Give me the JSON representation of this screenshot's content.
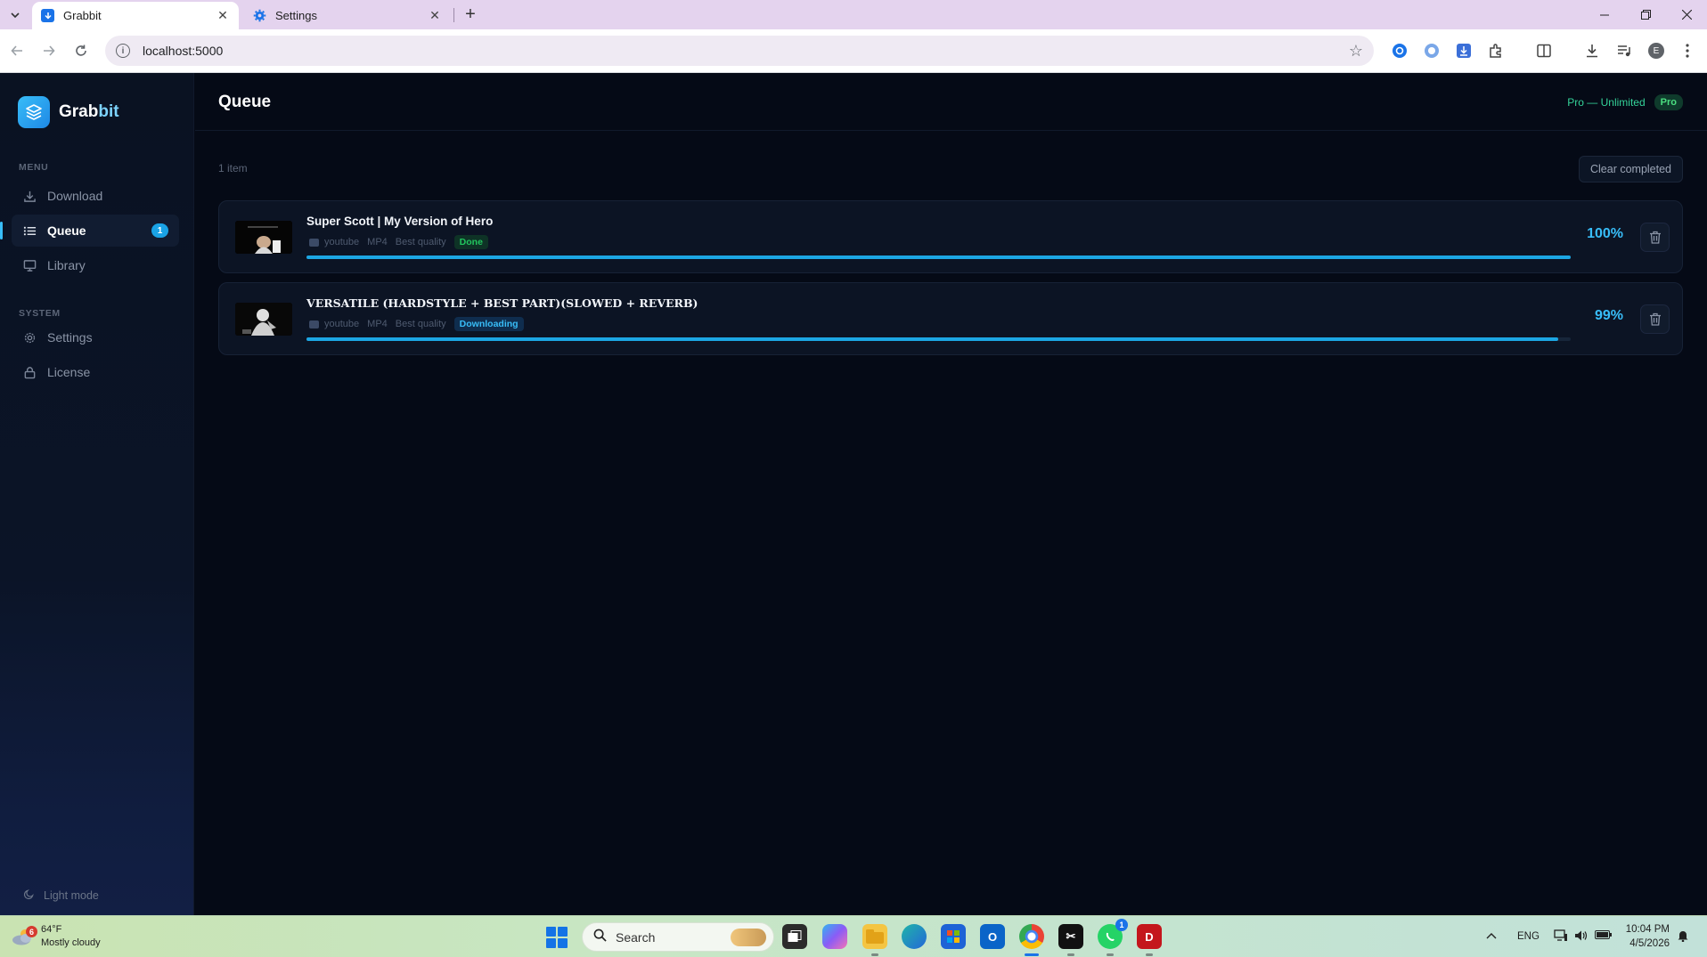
{
  "browser": {
    "tabs": [
      {
        "title": "Grabbit",
        "active": true
      },
      {
        "title": "Settings",
        "active": false
      }
    ],
    "url": "localhost:5000",
    "profile_initial": "E"
  },
  "sidebar": {
    "brand_prefix": "Grab",
    "brand_suffix": "bit",
    "menu_label": "MENU",
    "menu_items": [
      {
        "label": "Download",
        "icon": "download-icon"
      },
      {
        "label": "Queue",
        "icon": "list-icon",
        "badge": "1",
        "active": true
      },
      {
        "label": "Library",
        "icon": "monitor-icon"
      }
    ],
    "system_label": "SYSTEM",
    "system_items": [
      {
        "label": "Settings",
        "icon": "gear-icon"
      },
      {
        "label": "License",
        "icon": "lock-icon"
      }
    ],
    "light_mode_label": "Light mode"
  },
  "header": {
    "title": "Queue",
    "plan_text": "Pro — Unlimited",
    "plan_badge": "Pro"
  },
  "queue": {
    "count_text": "1 item",
    "clear_label": "Clear completed",
    "items": [
      {
        "title": "Super Scott | My Version of Hero",
        "source": "youtube",
        "format": "MP4",
        "quality": "Best quality",
        "status": "Done",
        "percent_text": "100%",
        "progress": 1.0
      },
      {
        "title": "VERSATILE (HARDSTYLE + BEST PART)(SLOWED + REVERB)",
        "source": "youtube",
        "format": "MP4",
        "quality": "Best quality",
        "status": "Downloading",
        "percent_text": "99%",
        "progress": 0.99
      }
    ]
  },
  "taskbar": {
    "weather_badge": "6",
    "temperature": "64°F",
    "condition": "Mostly cloudy",
    "search_placeholder": "Search",
    "whatsapp_badge": "1",
    "language": "ENG",
    "time": "10:04 PM",
    "date": "4/5/2026"
  },
  "colors": {
    "accent": "#38bdf8",
    "done": "#22c55e",
    "background": "#050a16"
  }
}
